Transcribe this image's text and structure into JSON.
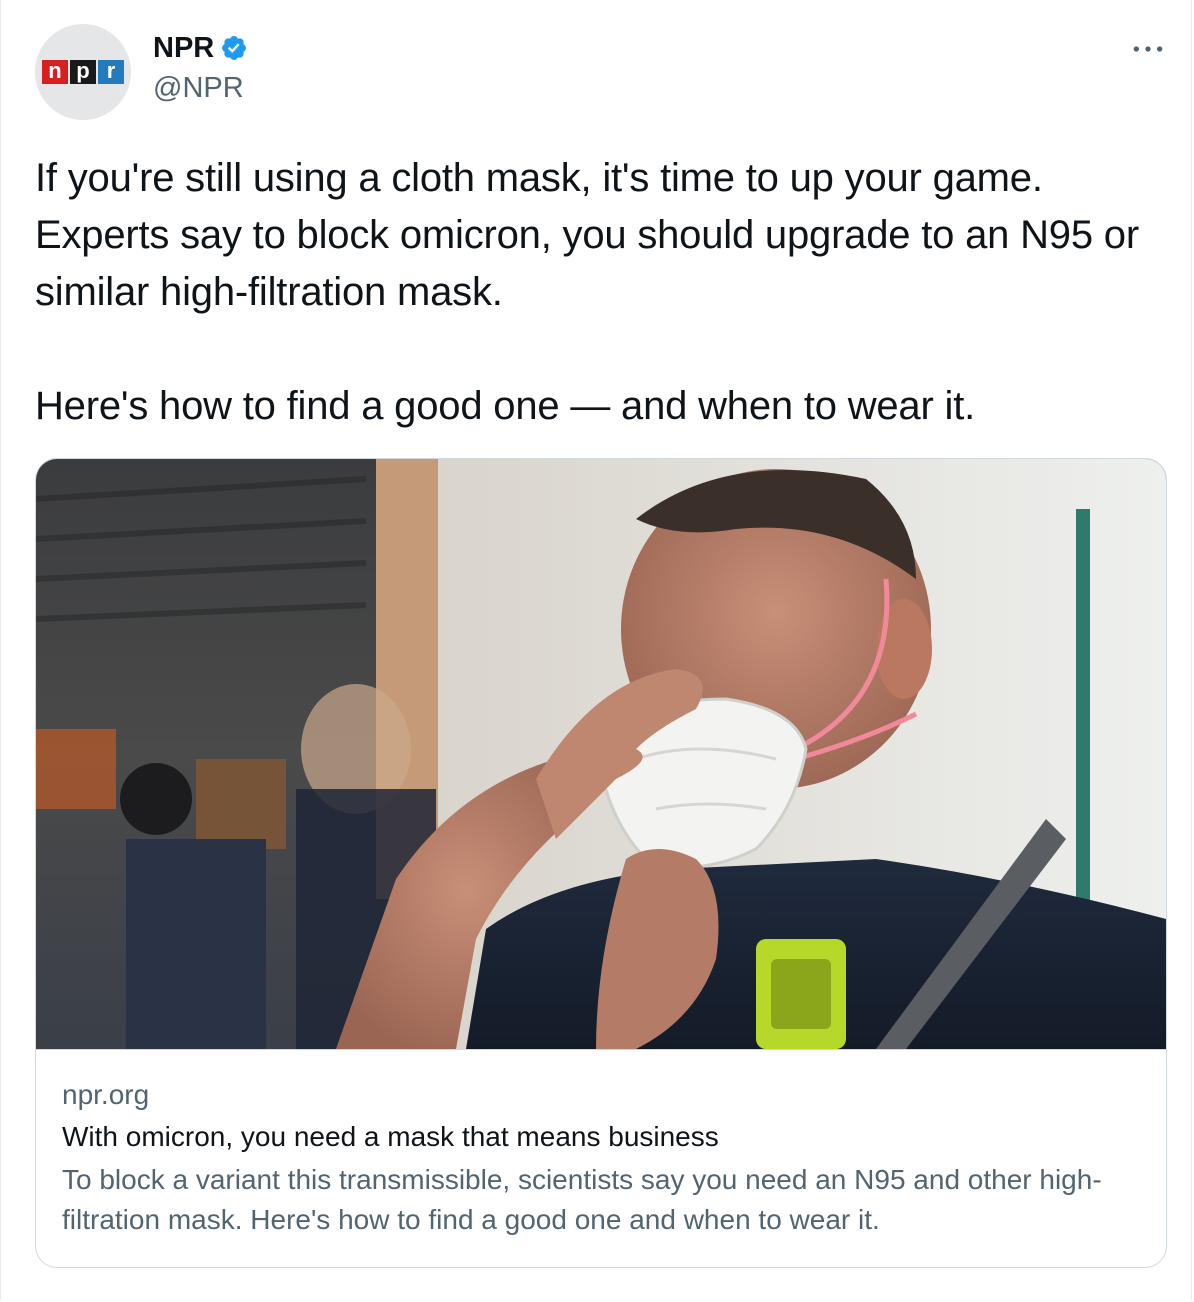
{
  "author": {
    "display_name": "NPR",
    "handle": "@NPR",
    "verified": true,
    "avatar_letters": [
      "n",
      "p",
      "r"
    ]
  },
  "colors": {
    "npr_red": "#d62021",
    "npr_black": "#1a1a1a",
    "npr_blue": "#237bbd",
    "verified_blue": "#1d9bf0",
    "secondary_text": "#536471"
  },
  "tweet": {
    "paragraph_1": "If you're still using a cloth mask, it's time to up your game. Experts say to block omicron, you should upgrade to an N95 or similar high-filtration mask.",
    "paragraph_2": "Here's how to find a good one — and when to wear it."
  },
  "card": {
    "domain": "npr.org",
    "title": "With omicron, you need a mask that means business",
    "description": "To block a variant this transmissible, scientists say you need an N95 and other high-filtration mask. Here's how to find a good one and when to wear it."
  },
  "icons": {
    "more": "more-horizontal-icon",
    "verified": "verified-badge-icon"
  }
}
